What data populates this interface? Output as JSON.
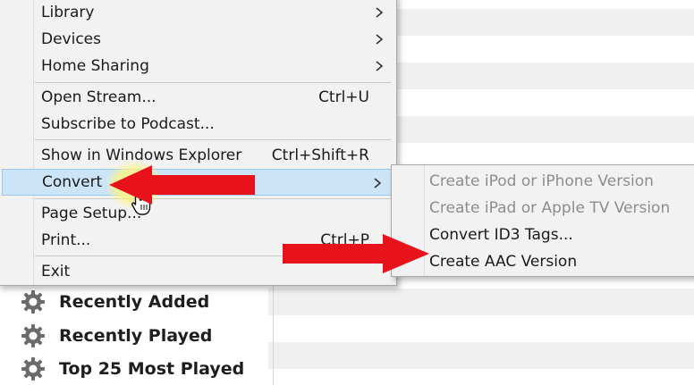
{
  "main_menu": {
    "items": [
      {
        "label": "Library",
        "shortcut": "",
        "submenu": true
      },
      {
        "label": "Devices",
        "shortcut": "",
        "submenu": true
      },
      {
        "label": "Home Sharing",
        "shortcut": "",
        "submenu": true
      },
      {
        "label": "Open Stream...",
        "shortcut": "Ctrl+U",
        "submenu": false
      },
      {
        "label": "Subscribe to Podcast...",
        "shortcut": "",
        "submenu": false
      },
      {
        "label": "Show in Windows Explorer",
        "shortcut": "Ctrl+Shift+R",
        "submenu": false
      },
      {
        "label": "Convert",
        "shortcut": "",
        "submenu": true,
        "highlighted": true
      },
      {
        "label": "Page Setup...",
        "shortcut": "",
        "submenu": false
      },
      {
        "label": "Print...",
        "shortcut": "Ctrl+P",
        "submenu": false
      },
      {
        "label": "Exit",
        "shortcut": "",
        "submenu": false
      }
    ]
  },
  "convert_submenu": {
    "items": [
      {
        "label": "Create iPod or iPhone Version",
        "enabled": false
      },
      {
        "label": "Create iPad or Apple TV Version",
        "enabled": false
      },
      {
        "label": "Convert ID3 Tags...",
        "enabled": true
      },
      {
        "label": "Create AAC Version",
        "enabled": true
      }
    ]
  },
  "sidebar": {
    "playlists": [
      {
        "label": "Recently Added",
        "icon": "gear-icon"
      },
      {
        "label": "Recently Played",
        "icon": "gear-icon"
      },
      {
        "label": "Top 25 Most Played",
        "icon": "gear-icon"
      }
    ]
  },
  "colors": {
    "highlight": "#cce4f7",
    "annotation_arrow": "#e8121a",
    "disabled_text": "#8d8d8d"
  }
}
